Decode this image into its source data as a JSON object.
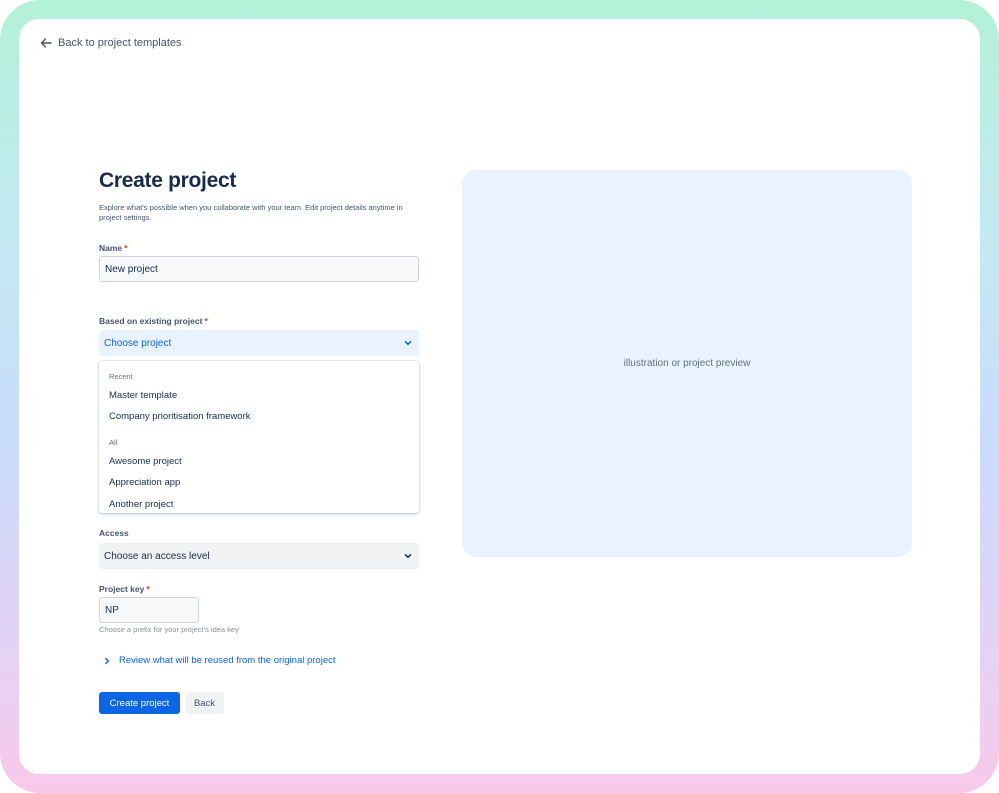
{
  "nav": {
    "back_label": "Back to project templates"
  },
  "form": {
    "title": "Create project",
    "subtitle": "Explore what's possible when you collaborate with your team. Edit project details anytime in project settings.",
    "name": {
      "label": "Name",
      "required": "*",
      "value": "New project"
    },
    "based_on": {
      "label": "Based on existing project",
      "required": "*",
      "placeholder": "Choose project",
      "menu": {
        "recent_label": "Recent",
        "recent": [
          "Master template",
          "Company prioritisation framework"
        ],
        "all_label": "All",
        "all": [
          "Awesome project",
          "Appreciation app",
          "Another project"
        ]
      }
    },
    "access": {
      "label": "Access",
      "placeholder": "Choose an access level"
    },
    "project_key": {
      "label": "Project key",
      "required": "*",
      "value": "NP",
      "helper": "Choose a prefix for your project's idea key"
    },
    "review_label": "Review what will be reused from the original project",
    "create_button": "Create project",
    "back_button": "Back"
  },
  "preview": {
    "label": "illustration or project preview"
  },
  "colors": {
    "primary": "#0c66e4",
    "required": "#de350b",
    "preview_bg": "#e9f2ff"
  }
}
